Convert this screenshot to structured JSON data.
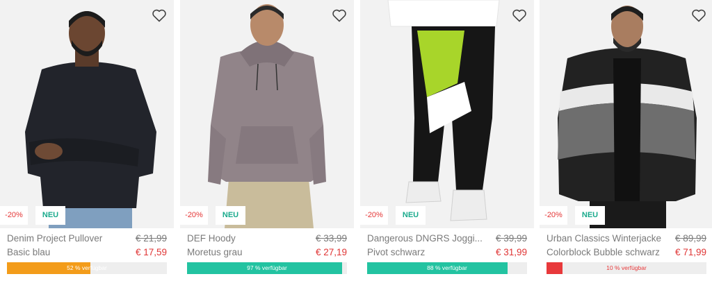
{
  "products": [
    {
      "badge_discount": "-20%",
      "badge_new": "NEU",
      "name": "Denim Project Pullover",
      "variant": "Basic blau",
      "old_price": "€ 21,99",
      "new_price": "€ 17,59",
      "availability_label": "52 % verfügbar",
      "availability_pct": 52,
      "bar_color": "#f39c1a",
      "label_color": "#ffffff",
      "photo_subject": "man in black sweatshirt"
    },
    {
      "badge_discount": "-20%",
      "badge_new": "NEU",
      "name": "DEF Hoody",
      "variant": "Moretus grau",
      "old_price": "€ 33,99",
      "new_price": "€ 27,19",
      "availability_label": "97 % verfügbar",
      "availability_pct": 97,
      "bar_color": "#23c3a1",
      "label_color": "#ffffff",
      "photo_subject": "man in grey hoodie"
    },
    {
      "badge_discount": "-20%",
      "badge_new": "NEU",
      "name": "Dangerous DNGRS Joggi...",
      "variant": "Pivot schwarz",
      "old_price": "€ 39,99",
      "new_price": "€ 31,99",
      "availability_label": "88 % verfügbar",
      "availability_pct": 88,
      "bar_color": "#23c3a1",
      "label_color": "#ffffff",
      "photo_subject": "black jogging pants with green and white print"
    },
    {
      "badge_discount": "-20%",
      "badge_new": "NEU",
      "name": "Urban Classics Winterjacke",
      "variant": "Colorblock Bubble schwarz",
      "old_price": "€ 89,99",
      "new_price": "€ 71,99",
      "availability_label": "10 % verfügbar",
      "availability_pct": 10,
      "bar_color": "#e8393b",
      "label_color": "#e8393b",
      "photo_subject": "man in colorblock puffer jacket"
    }
  ],
  "icons": {
    "wishlist": "heart-outline-icon"
  }
}
